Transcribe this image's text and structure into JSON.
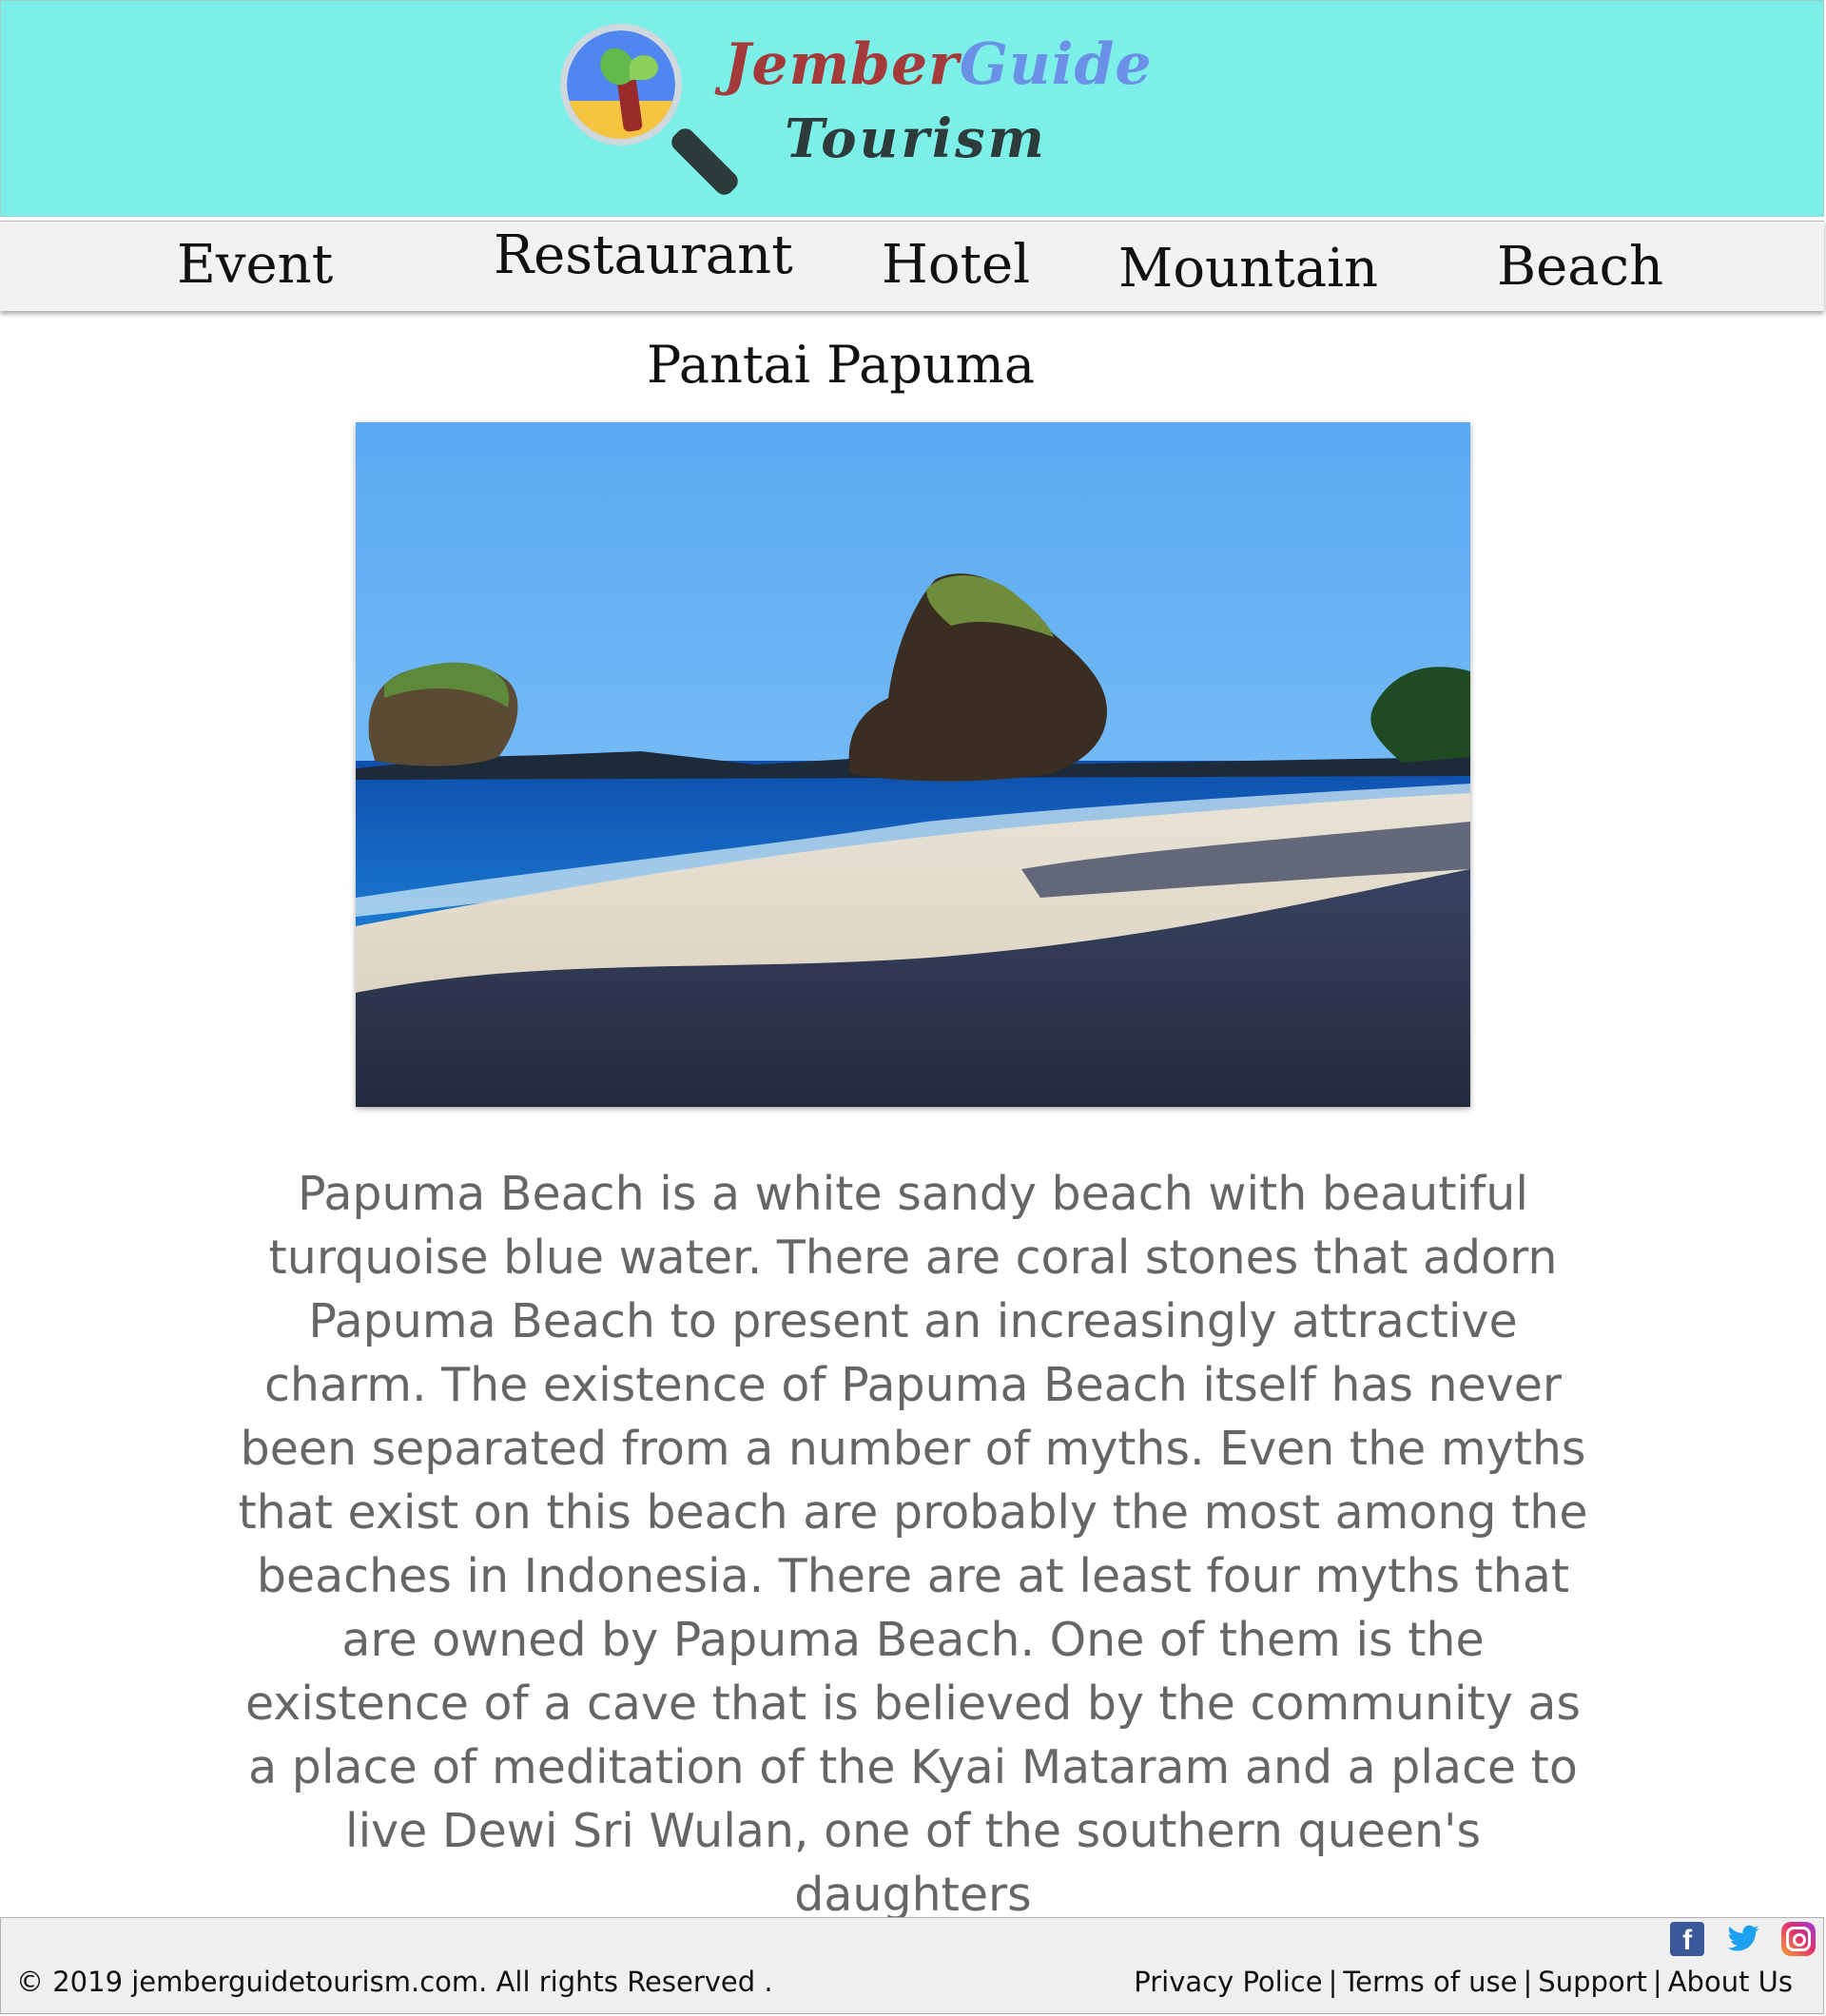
{
  "header": {
    "logo_word_1": "Jember",
    "logo_word_2": "Guide",
    "logo_word_3": "Tourism"
  },
  "nav": {
    "items": [
      {
        "label": "Event"
      },
      {
        "label": "Restaurant"
      },
      {
        "label": "Hotel"
      },
      {
        "label": "Mountain"
      },
      {
        "label": "Beach"
      }
    ]
  },
  "main": {
    "title": "Pantai Papuma",
    "description": "Papuma Beach is a white sandy beach with beautiful turquoise blue water. There are coral stones that adorn Papuma Beach to present an increasingly attractive charm. The existence of Papuma Beach itself has never been separated from a number of myths. Even the myths that exist on this beach are probably the most among the beaches in Indonesia. There are at least four myths that are owned by Papuma Beach. One of them is the existence of a cave that is believed by the community as a place of meditation of the Kyai Mataram and a place to live Dewi Sri Wulan, one of the southern queen's daughters"
  },
  "footer": {
    "copyright": "© 2019 jemberguidetourism.com. All rights Reserved .",
    "links": [
      {
        "label": "Privacy Police"
      },
      {
        "label": "Terms of use"
      },
      {
        "label": "Support"
      },
      {
        "label": "About Us"
      }
    ],
    "separator": "|",
    "socials": [
      {
        "icon": "facebook-icon",
        "glyph": "f"
      },
      {
        "icon": "twitter-icon"
      },
      {
        "icon": "instagram-icon"
      }
    ]
  },
  "colors": {
    "header_bg": "#7cefe8",
    "nav_bg": "#f2f2f2",
    "desc_text": "#666666",
    "footer_bg": "#f0efef"
  }
}
